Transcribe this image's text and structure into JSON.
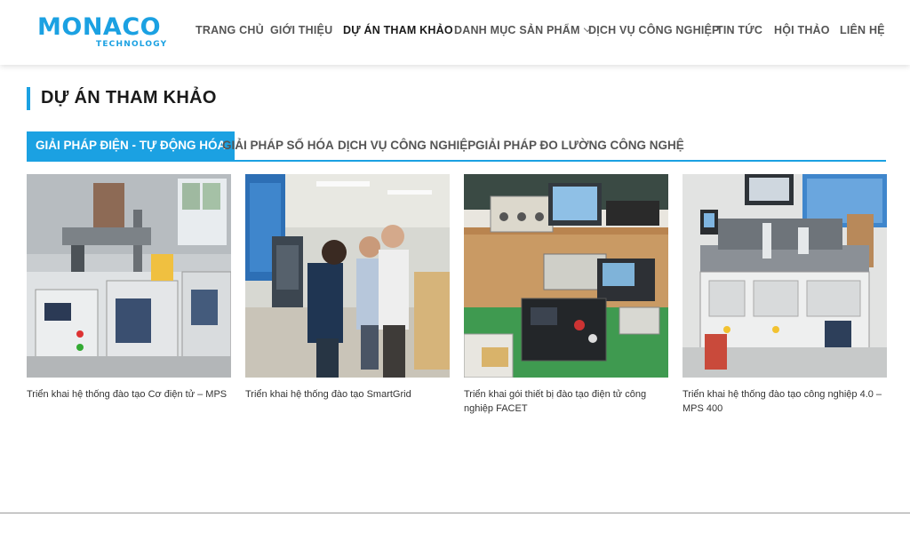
{
  "logo": {
    "main": "MONACO",
    "sub": "TECHNOLOGY"
  },
  "nav": {
    "items": [
      {
        "label": "TRANG CHỦ"
      },
      {
        "label": "GIỚI THIỆU"
      },
      {
        "label": "DỰ ÁN THAM KHẢO"
      },
      {
        "label": "DANH MỤC SẢN PHẨM"
      },
      {
        "label": "DỊCH VỤ CÔNG NGHIỆP"
      },
      {
        "label": "TIN TỨC"
      },
      {
        "label": "HỘI THẢO"
      },
      {
        "label": "LIÊN HỆ"
      }
    ],
    "active_index": 2
  },
  "page": {
    "title": "DỰ ÁN THAM KHẢO"
  },
  "tabs": [
    {
      "label": "GIẢI PHÁP ĐIỆN - TỰ ĐỘNG HÓA"
    },
    {
      "label": "GIẢI PHÁP SỐ HÓA"
    },
    {
      "label": "DỊCH VỤ CÔNG NGHIỆP"
    },
    {
      "label": "GIẢI PHÁP ĐO LƯỜNG CÔNG NGHỆ"
    }
  ],
  "projects": [
    {
      "caption": "Triển khai hệ thống đào tạo Cơ điện tử – MPS"
    },
    {
      "caption": "Triển khai hệ thống đào tạo SmartGrid"
    },
    {
      "caption": "Triển khai gói thiết bị đào tạo điện tử công nghiệp FACET"
    },
    {
      "caption": "Triển khai hệ thống đào tạo công nghiệp 4.0 – MPS 400"
    }
  ],
  "colors": {
    "accent": "#1ba1e2",
    "text": "#333333"
  }
}
